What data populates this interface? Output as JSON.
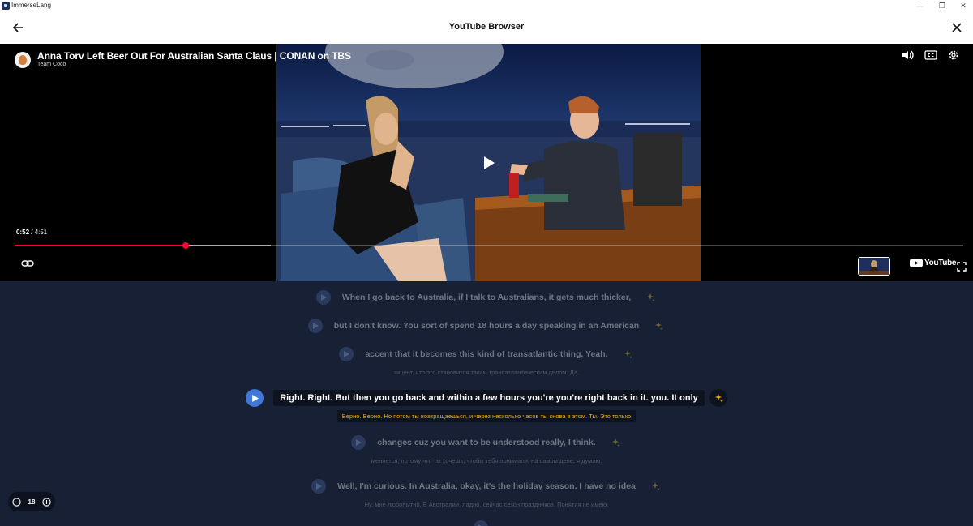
{
  "window": {
    "app_name": "ImmerseLang"
  },
  "header": {
    "title": "YouTube Browser"
  },
  "video": {
    "title": "Anna Torv Left Beer Out For Australian Santa Claus | CONAN on TBS",
    "channel": "Team Coco",
    "current_time": "0:52",
    "separator": " / ",
    "duration": "4:51",
    "progress": 0.18,
    "buffered": 0.27,
    "brand": "YouTube"
  },
  "subtitles": [
    {
      "text": "When I go back to Australia, if I talk to Australians, it gets much thicker,",
      "translation": ""
    },
    {
      "text": "but I don't know. You sort of spend 18 hours a day speaking in an American",
      "translation": ""
    },
    {
      "text": "accent that it becomes this kind of transatlantic thing. Yeah.",
      "translation": "акцент, что это становится таким трансатлантическим делом. Да."
    },
    {
      "text": "Right. Right. But then you go back and within a few hours you're you're right back in it. you. It only",
      "translation": "Верно. Верно. Но потом ты возвращаешься, и через несколько часов ты снова в этом. Ты. Это только",
      "active": true
    },
    {
      "text": "changes cuz you want to be understood really, I think.",
      "translation": "меняется, потому что ты хочешь, чтобы тебя понимали, на самом деле, я думаю."
    },
    {
      "text": "Well, I'm curious. In Australia, okay, it's the holiday season. I have no idea",
      "translation": "Ну, мне любопытно. В Австралии, ладно, сейчас сезон праздников. Понятия не имею,"
    }
  ],
  "font_control": {
    "value": "18"
  },
  "colors": {
    "accent": "#3f78d8",
    "progress": "#ff0033",
    "translation_active": "#f4b400",
    "background": "#172034"
  }
}
